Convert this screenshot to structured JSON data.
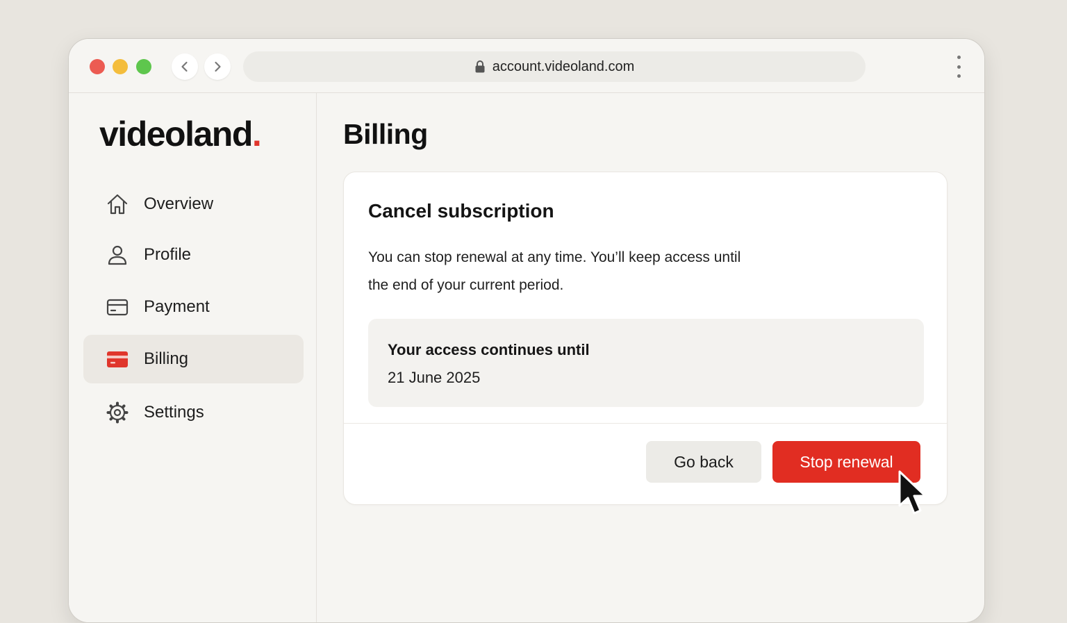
{
  "browser": {
    "url": "account.videoland.com",
    "icons": {
      "back": "chevron-left-icon",
      "forward": "chevron-right-icon",
      "lock": "lock-icon",
      "menu": "more-vertical-icon"
    }
  },
  "sidebar": {
    "logo": "videoland",
    "logo_dot": ".",
    "logo_dot_color": "#e0362c",
    "items": [
      {
        "label": "Overview",
        "icon": "home-icon",
        "active": false
      },
      {
        "label": "Profile",
        "icon": "user-icon",
        "active": false
      },
      {
        "label": "Payment",
        "icon": "credit-card-icon",
        "active": false
      },
      {
        "label": "Billing",
        "icon": "billing-card-icon",
        "active": true
      },
      {
        "label": "Settings",
        "icon": "gear-icon",
        "active": false
      }
    ]
  },
  "main": {
    "title": "Billing",
    "card": {
      "title": "Cancel subscription",
      "description": "You can stop renewal at any time. You’ll keep access until the end of your current period.",
      "info_label": "Your access continues until",
      "info_value": "21 June 2025",
      "secondary_button": "Go back",
      "primary_button": "Stop renewal"
    }
  },
  "colors": {
    "accent": "#e12d22",
    "background": "#e8e5df",
    "window": "#f6f5f2",
    "active_nav": "#ebe8e3"
  }
}
